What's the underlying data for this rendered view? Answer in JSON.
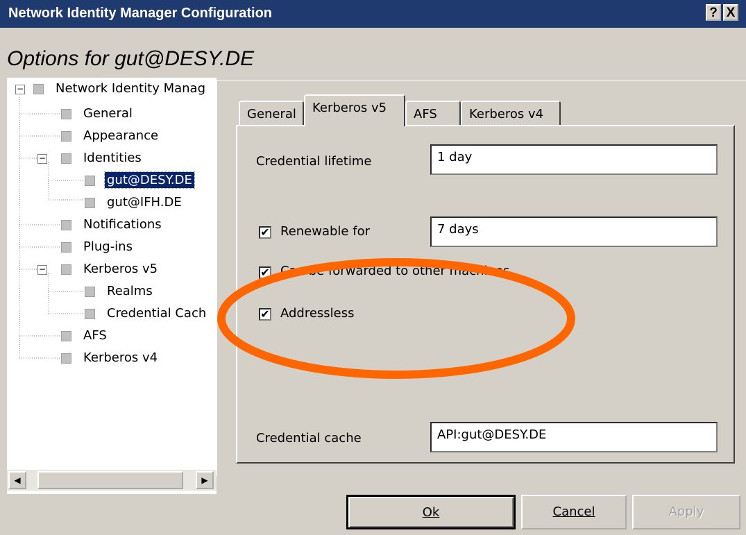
{
  "window": {
    "title": "Network Identity Manager Configuration",
    "help_button": "?",
    "close_button": "X"
  },
  "heading": "Options for gut@DESY.DE",
  "tree": {
    "root": "Network Identity Manag",
    "items": [
      "General",
      "Appearance",
      "Identities",
      "gut@DESY.DE",
      "gut@IFH.DE",
      "Notifications",
      "Plug-ins",
      "Kerberos v5",
      "Realms",
      "Credential Cach",
      "AFS",
      "Kerberos v4"
    ],
    "selected": "gut@DESY.DE"
  },
  "tabs": [
    "General",
    "Kerberos v5",
    "AFS",
    "Kerberos v4"
  ],
  "active_tab": "Kerberos v5",
  "form": {
    "lifetime_label": "Credential lifetime",
    "lifetime_value": "1 day",
    "renewable_label": "Renewable for",
    "renewable_value": "7 days",
    "forwarded_label": "Can be forwarded to other machines",
    "addressless_label": "Addressless",
    "cache_label": "Credential cache",
    "cache_value": "API:gut@DESY.DE",
    "check_mark": "✔"
  },
  "buttons": {
    "ok": "Ok",
    "cancel": "Cancel",
    "apply": "Apply"
  },
  "colors": {
    "titlebar": "#1f3a6e",
    "selection": "#0a246a",
    "annotation": "#ff6600",
    "face": "#d4d0c8"
  }
}
